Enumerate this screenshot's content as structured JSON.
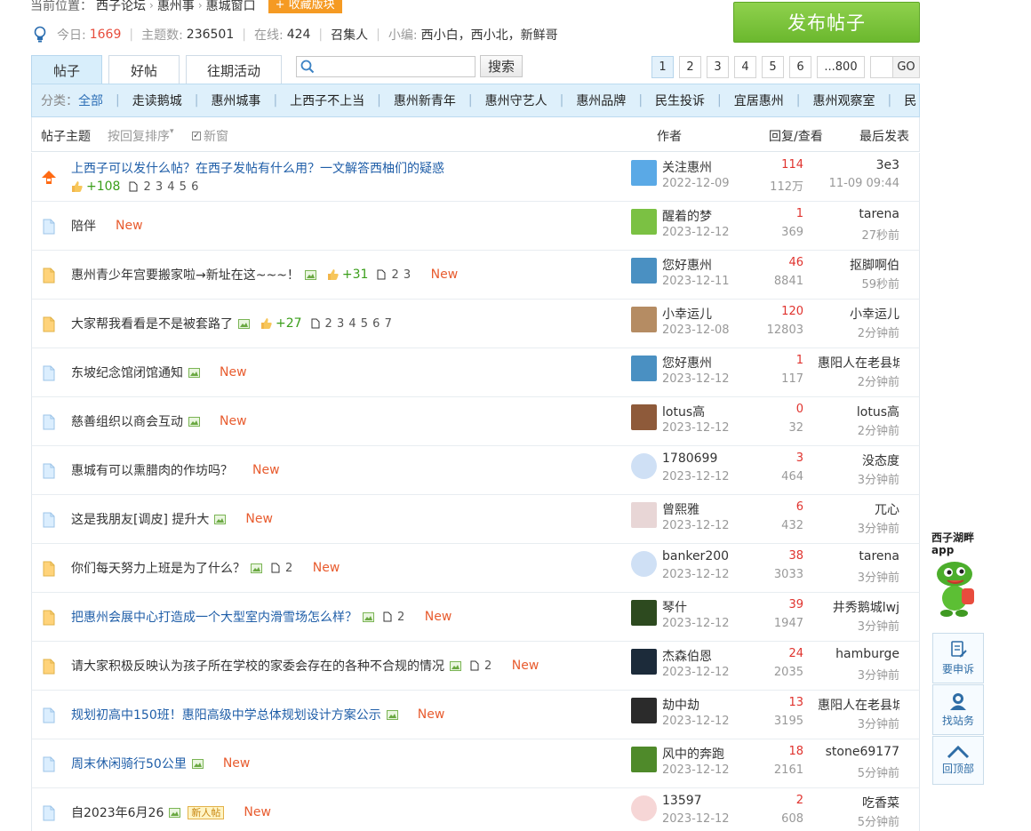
{
  "breadcrumb": {
    "prefix": "当前位置：",
    "items": [
      "西子论坛",
      "惠州事",
      "惠城窗口"
    ],
    "favorite": "+ 收藏版块"
  },
  "stats": {
    "today_label": "今日:",
    "today": "1669",
    "topics_label": "主题数:",
    "topics": "236501",
    "online_label": "在线:",
    "online": "424",
    "convener": "召集人",
    "editors_label": "小编:",
    "editors": "西小白，西小北，新鲜哥"
  },
  "post_button": "发布帖子",
  "tabs": [
    "帖子",
    "好帖",
    "往期活动"
  ],
  "search": {
    "placeholder": "",
    "button": "搜索"
  },
  "pagination": {
    "pages": [
      "1",
      "2",
      "3",
      "4",
      "5",
      "6",
      "...800"
    ],
    "go": "GO"
  },
  "categories": {
    "label": "分类：",
    "items": [
      "全部",
      "走读鹅城",
      "惠州城事",
      "上西子不上当",
      "惠州新青年",
      "惠州守艺人",
      "惠州品牌",
      "民生投诉",
      "宜居惠州",
      "惠州观察室",
      "民"
    ]
  },
  "table_header": {
    "subject": "帖子主题",
    "sort": "按回复排序",
    "new_window": "新窗",
    "author": "作者",
    "reply_view": "回复/查看",
    "last_post": "最后发表"
  },
  "threads": [
    {
      "title": "上西子可以发什么帖？在西子发帖有什么用？一文解答西柚们的疑惑",
      "pinned": true,
      "likes": "+108",
      "pages": "2 3 4 5 6",
      "author": "关注惠州",
      "date": "2022-12-09",
      "replies": "114",
      "views": "112万",
      "last_user": "3e3",
      "last_time": "11-09 09:44"
    },
    {
      "title": "陪伴",
      "is_new": true,
      "new_label": "New",
      "author": "醒着的梦",
      "date": "2023-12-12",
      "replies": "1",
      "views": "369",
      "last_user": "tarena",
      "last_time": "27秒前"
    },
    {
      "title": "惠州青少年宫要搬家啦→新址在这~~~！",
      "img": true,
      "likes": "+31",
      "pages": "2 3",
      "is_new": true,
      "new_label": "New",
      "author": "您好惠州",
      "date": "2023-12-11",
      "replies": "46",
      "views": "8841",
      "last_user": "抠脚啊伯",
      "last_time": "59秒前"
    },
    {
      "title": "大家帮我看看是不是被套路了",
      "img": true,
      "likes": "+27",
      "pages": "2 3 4 5 6 7",
      "author": "小幸运儿",
      "date": "2023-12-08",
      "replies": "120",
      "views": "12803",
      "last_user": "小幸运儿",
      "last_time": "2分钟前"
    },
    {
      "title": "东坡纪念馆闭馆通知",
      "img": true,
      "is_new": true,
      "new_label": "New",
      "author": "您好惠州",
      "date": "2023-12-12",
      "replies": "1",
      "views": "117",
      "last_user": "惠阳人在老县城",
      "last_time": "2分钟前"
    },
    {
      "title": "慈善组织以商会互动",
      "img": true,
      "is_new": true,
      "new_label": "New",
      "author": "lotus高",
      "date": "2023-12-12",
      "replies": "0",
      "views": "32",
      "last_user": "lotus高",
      "last_time": "2分钟前"
    },
    {
      "title": "惠城有可以熏腊肉的作坊吗？",
      "is_new": true,
      "new_label": "New",
      "author": "1780699",
      "date": "2023-12-12",
      "replies": "3",
      "views": "464",
      "last_user": "没态度",
      "last_time": "3分钟前"
    },
    {
      "title": "这是我朋友[调皮] 提升大",
      "img": true,
      "is_new": true,
      "new_label": "New",
      "author": "曾熙雅",
      "date": "2023-12-12",
      "replies": "6",
      "views": "432",
      "last_user": "兀心",
      "last_time": "3分钟前"
    },
    {
      "title": "你们每天努力上班是为了什么？",
      "img": true,
      "pages": "2",
      "is_new": true,
      "new_label": "New",
      "author": "banker2009",
      "date": "2023-12-12",
      "replies": "38",
      "views": "3033",
      "last_user": "tarena",
      "last_time": "3分钟前"
    },
    {
      "title": "把惠州会展中心打造成一个大型室内滑雪场怎么样？",
      "img": true,
      "pages": "2",
      "is_new": true,
      "new_label": "New",
      "author": "琴什",
      "date": "2023-12-12",
      "replies": "39",
      "views": "1947",
      "last_user": "井秀鹅城lwj",
      "last_time": "3分钟前"
    },
    {
      "title": "请大家积极反映认为孩子所在学校的家委会存在的各种不合规的情况",
      "img": true,
      "pages": "2",
      "is_new": true,
      "new_label": "New",
      "author": "杰森伯恩",
      "date": "2023-12-12",
      "replies": "24",
      "views": "2035",
      "last_user": "hamburge",
      "last_time": "3分钟前"
    },
    {
      "title": "规划初高中150班！惠阳高级中学总体规划设计方案公示",
      "img": true,
      "is_new": true,
      "new_label": "New",
      "author": "劫中劫",
      "date": "2023-12-12",
      "replies": "13",
      "views": "3195",
      "last_user": "惠阳人在老县城",
      "last_time": "3分钟前"
    },
    {
      "title": "周末休闲骑行50公里",
      "img": true,
      "is_new": true,
      "new_label": "New",
      "author": "风中的奔跑",
      "date": "2023-12-12",
      "replies": "18",
      "views": "2161",
      "last_user": "stone69177",
      "last_time": "5分钟前"
    },
    {
      "title": "自2023年6月26",
      "img": true,
      "newbie_badge": "新人帖",
      "is_new": true,
      "new_label": "New",
      "author": "13597",
      "date": "2023-12-12",
      "replies": "2",
      "views": "608",
      "last_user": "吃香菜",
      "last_time": "5分钟前"
    }
  ],
  "side": {
    "app_title": "西子湖畔",
    "app_sub": "app",
    "appeal": "要申诉",
    "find_station": "找站务",
    "back_top": "回顶部"
  }
}
